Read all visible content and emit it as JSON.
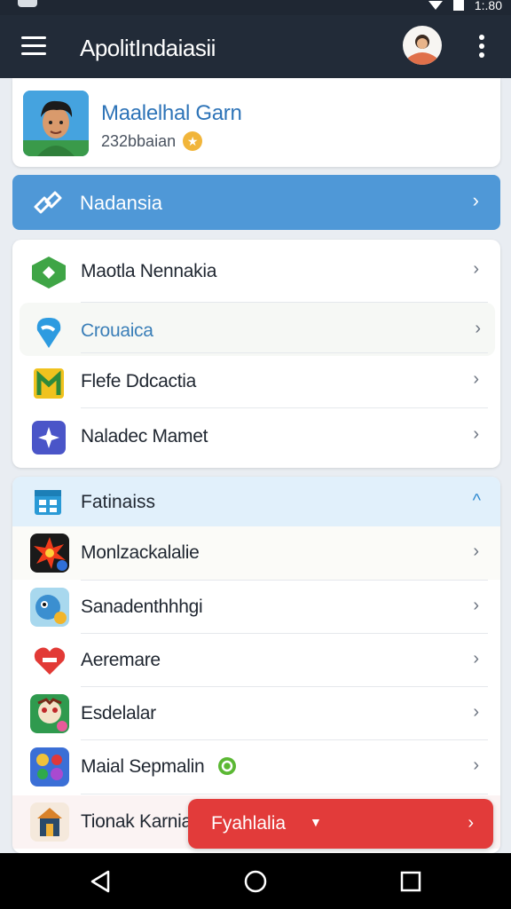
{
  "app_bar": {
    "title": "ApolitIndaiasii",
    "menu_icon": "menu-icon",
    "avatar_icon": "avatar-icon",
    "overflow_icon": "more-vert-icon"
  },
  "status_bar": {
    "time": "1:.80"
  },
  "profile": {
    "name": "Maalelhal Garn",
    "subtitle": "232bbaian",
    "badge_icon": "star-icon"
  },
  "banner": {
    "label": "Nadansia",
    "icon": "link-icon",
    "color": "#4f98d7"
  },
  "menu_list": [
    {
      "label": "Maotla Nennakia",
      "icon": "green-tag-icon"
    },
    {
      "label": "Crouaica",
      "icon": "blue-pin-icon"
    },
    {
      "label": "Flefe Ddcactia",
      "icon": "yellow-box-icon"
    },
    {
      "label": "Naladec Mamet",
      "icon": "sparkle-icon"
    }
  ],
  "section": {
    "title": "Fatinaiss",
    "icon": "grid-icon",
    "items": [
      {
        "label": "Monlzackalalie",
        "icon": "burst-app-icon"
      },
      {
        "label": "Sanadenthhhgi",
        "icon": "character-app-icon"
      },
      {
        "label": "Aeremare",
        "icon": "heart-app-icon"
      },
      {
        "label": "Esdelalar",
        "icon": "mask-app-icon"
      },
      {
        "label": "Maial Sepmalin",
        "icon": "puzzle-app-icon"
      },
      {
        "label": "Tionak Karnia",
        "icon": "tower-app-icon"
      }
    ]
  },
  "fab": {
    "label": "Fyahlalia",
    "color": "#e23b3a"
  },
  "navbar": {
    "back_icon": "back-icon",
    "home_icon": "home-icon",
    "recents_icon": "recents-icon"
  }
}
